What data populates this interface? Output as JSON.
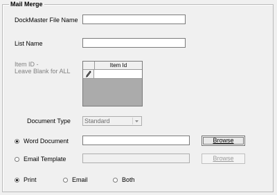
{
  "group": {
    "title": "Mail Merge"
  },
  "labels": {
    "file_name": "DockMaster File Name",
    "list_name": "List Name",
    "item_id_line1": "Item ID -",
    "item_id_line2": "Leave Blank for ALL",
    "document_type": "Document Type"
  },
  "fields": {
    "file_name": "",
    "list_name": "",
    "word_document": "",
    "email_template": ""
  },
  "grid": {
    "column_header": "Item Id",
    "row_indicator_icon": "pencil-icon"
  },
  "document_type": {
    "selected": "Standard"
  },
  "output": {
    "word_document": {
      "label": "Word Document",
      "checked": true
    },
    "email_template": {
      "label": "Email Template",
      "checked": false
    }
  },
  "buttons": {
    "browse": "Browse",
    "browse_disabled": "Browse"
  },
  "send": {
    "print": {
      "label": "Print",
      "checked": true
    },
    "email": {
      "label": "Email",
      "checked": false
    },
    "both": {
      "label": "Both",
      "checked": false
    }
  }
}
